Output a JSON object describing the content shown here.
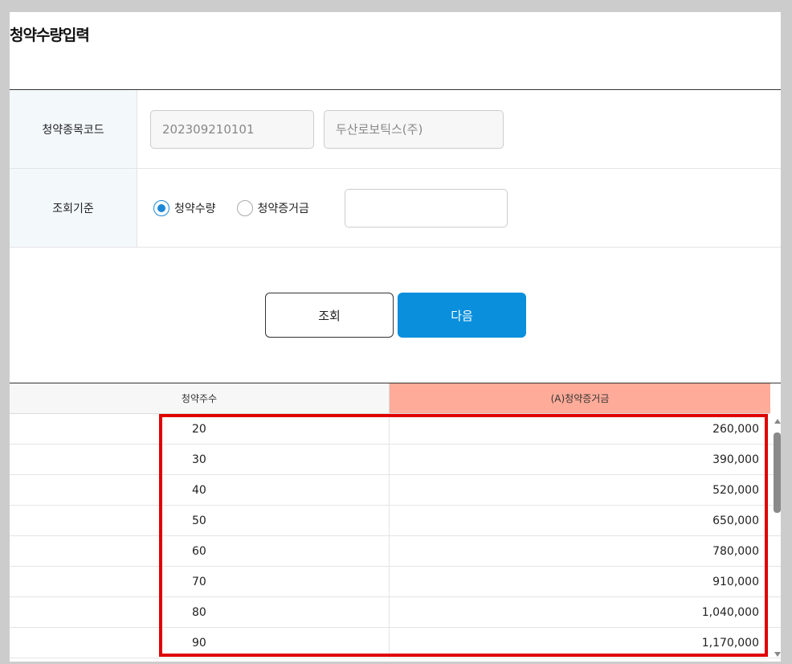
{
  "dialog": {
    "title": "청약수량입력"
  },
  "form": {
    "code_label": "청약종목코드",
    "code_value": "202309210101",
    "name_value": "두산로보틱스(주)",
    "criteria_label": "조회기준",
    "radio_quantity": "청약수량",
    "radio_deposit": "청약증거금",
    "criteria_value": ""
  },
  "buttons": {
    "search": "조회",
    "next": "다음"
  },
  "grid": {
    "columns": [
      "청약주수",
      "(A)청약증거금"
    ],
    "rows": [
      [
        "20",
        "260,000"
      ],
      [
        "30",
        "390,000"
      ],
      [
        "40",
        "520,000"
      ],
      [
        "50",
        "650,000"
      ],
      [
        "60",
        "780,000"
      ],
      [
        "70",
        "910,000"
      ],
      [
        "80",
        "1,040,000"
      ],
      [
        "90",
        "1,170,000"
      ]
    ]
  },
  "colors": {
    "primary_button": "#0a8fdd",
    "deposit_header": "#ffab99",
    "highlight_border": "#e00000",
    "label_bg": "#f3f8fb"
  },
  "selected_criteria": "청약수량"
}
